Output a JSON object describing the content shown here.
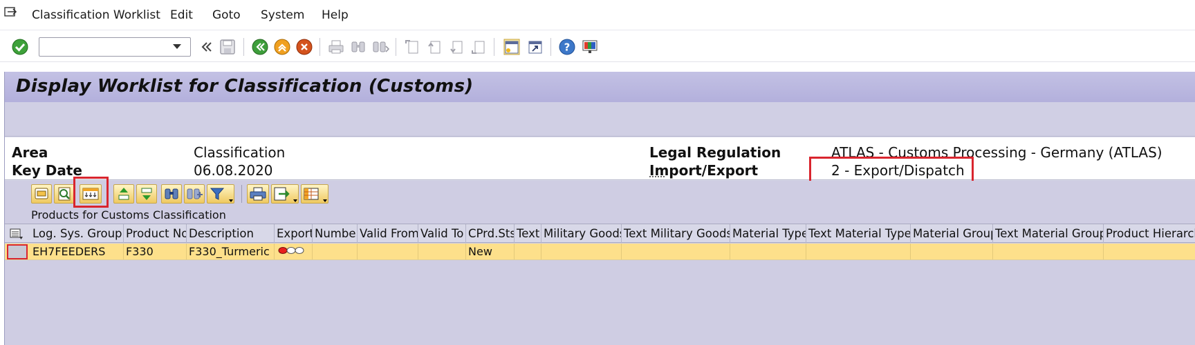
{
  "menu": {
    "items": [
      "Classification Worklist",
      "Edit",
      "Goto",
      "System",
      "Help"
    ]
  },
  "toolbar": {
    "command_field": {
      "value": "",
      "placeholder": ""
    },
    "icons": [
      "enter-icon",
      "command-dropdown-icon",
      "collapse-icon",
      "save-icon",
      "back-icon",
      "exit-icon",
      "cancel-icon",
      "print-icon",
      "find-icon",
      "find-next-icon",
      "first-page-icon",
      "previous-page-icon",
      "next-page-icon",
      "last-page-icon",
      "create-session-icon",
      "generate-shortcut-icon",
      "help-icon",
      "customize-layout-icon"
    ]
  },
  "page": {
    "title": "Display Worklist for Classification (Customs)"
  },
  "header": {
    "area_label": "Area",
    "area_value": "Classification",
    "key_date_label": "Key Date",
    "key_date_value": "06.08.2020",
    "legal_regulation_label": "Legal Regulation",
    "legal_regulation_value": "ATLAS - Customs Processing - Germany (ATLAS)",
    "import_export_label": "Import/Export",
    "import_export_value": "2 - Export/Dispatch"
  },
  "alv": {
    "title": "Products for Customs Classification",
    "buttons": [
      "details-icon",
      "check-icon",
      "change-layout-icon",
      "sort-ascending-icon",
      "sort-descending-icon",
      "find-icon",
      "find-next-icon",
      "filter-icon",
      "print-preview-icon",
      "export-icon",
      "select-layout-icon"
    ],
    "columns": [
      "Log. Sys. Group",
      "Product No",
      "Description",
      "Export",
      "Number",
      "Valid From",
      "Valid To",
      "CPrd.Sts",
      "Text",
      "Military Goods",
      "Text Military Goods",
      "Material Type",
      "Text Material Type",
      "Material Group",
      "Text Material Group",
      "Product Hierarchy"
    ],
    "rows": [
      {
        "log_sys_group": "EH7FEEDERS",
        "product_no": "F330",
        "description": "F330_Turmeric",
        "export_status": "red",
        "number": "",
        "valid_from": "",
        "valid_to": "",
        "cprd_sts": "New",
        "text": "",
        "military_goods": "",
        "text_military_goods": "",
        "material_type": "",
        "text_material_type": "",
        "material_group": "",
        "text_material_group": "",
        "product_hierarchy": ""
      }
    ]
  },
  "colors": {
    "title_bar": "#b8b5de",
    "row_highlight": "#fde08b",
    "annotation_red": "#d9252e",
    "alv_bg": "#cfcde3"
  }
}
